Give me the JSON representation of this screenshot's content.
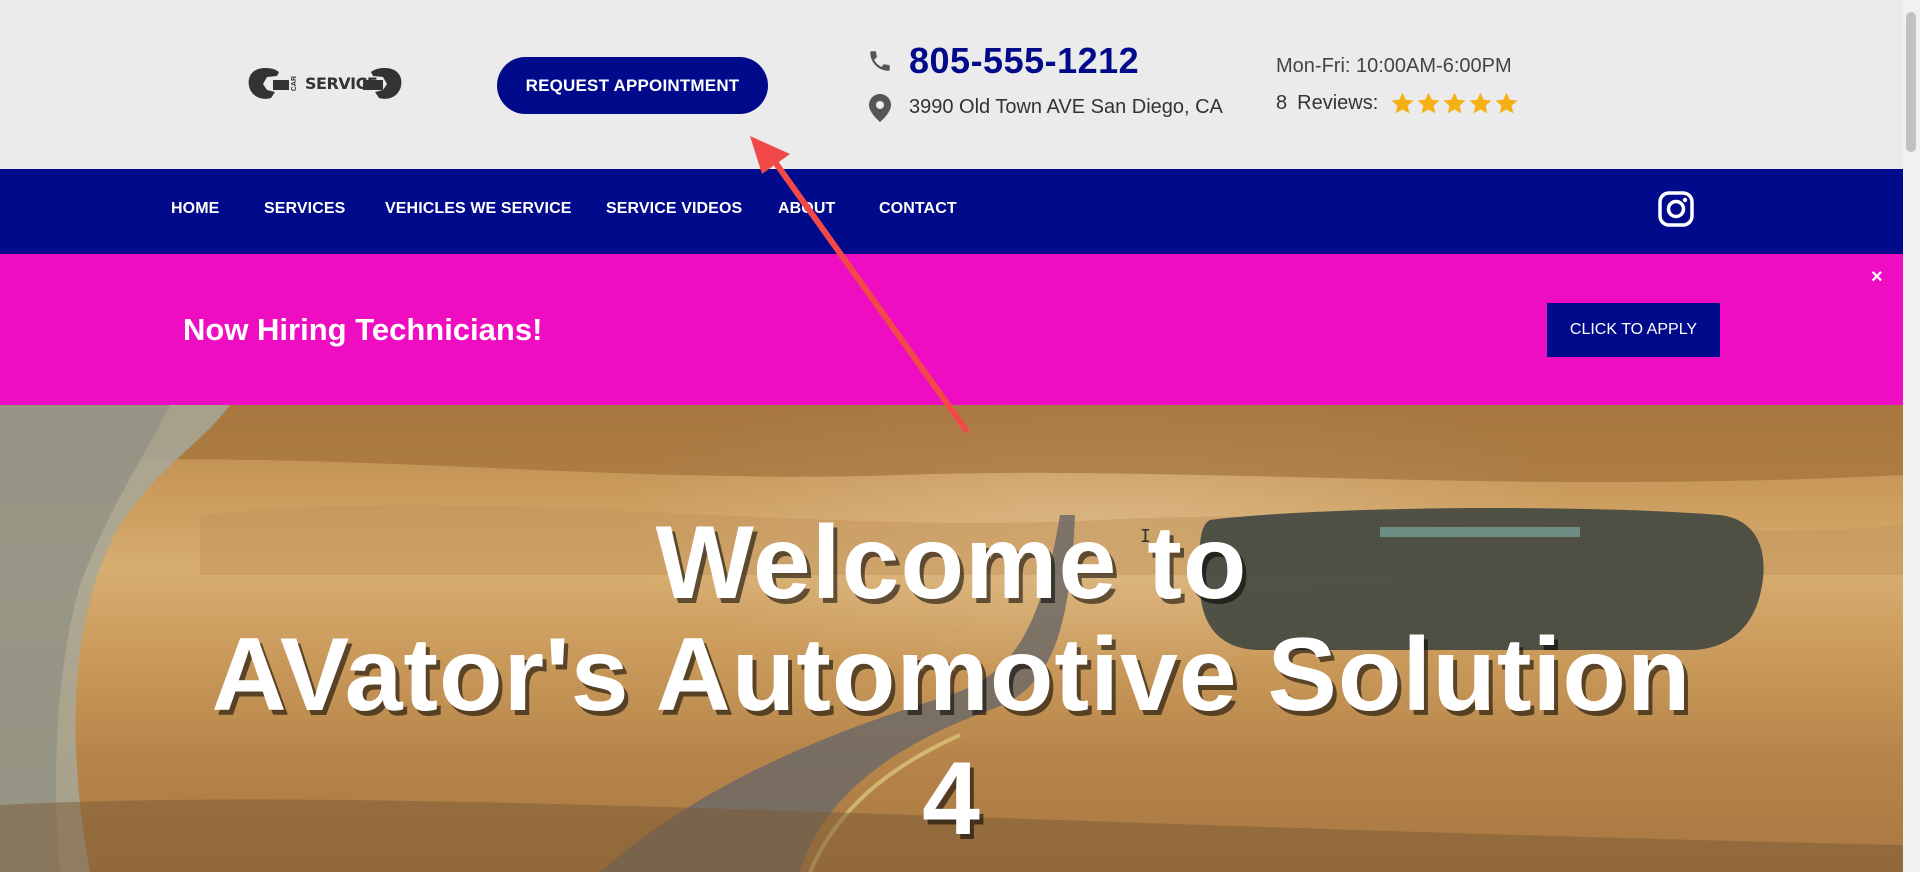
{
  "header": {
    "logo_text": "SERVICE",
    "logo_small": "CAR",
    "appointment_label": "REQUEST APPOINTMENT",
    "phone": "805-555-1212",
    "address": "3990 Old Town AVE San Diego, CA",
    "hours": "Mon-Fri: 10:00AM-6:00PM",
    "review_count": "8",
    "reviews_label": "Reviews:",
    "rating": 5,
    "star_color": "#f5b014"
  },
  "nav": {
    "items": [
      {
        "label": "HOME"
      },
      {
        "label": "SERVICES"
      },
      {
        "label": "VEHICLES WE SERVICE"
      },
      {
        "label": "SERVICE VIDEOS"
      },
      {
        "label": "ABOUT"
      },
      {
        "label": "CONTACT"
      }
    ],
    "social_icon": "instagram-icon"
  },
  "banner": {
    "text": "Now Hiring Technicians!",
    "button_label": "CLICK TO APPLY",
    "close_label": "×",
    "background": "#ee0dc0"
  },
  "hero": {
    "line1": "Welcome to",
    "line2": "AVator's Automotive Solution",
    "line3": "4"
  },
  "colors": {
    "brand_blue": "#000a8a",
    "annotation_arrow": "#f24848"
  }
}
